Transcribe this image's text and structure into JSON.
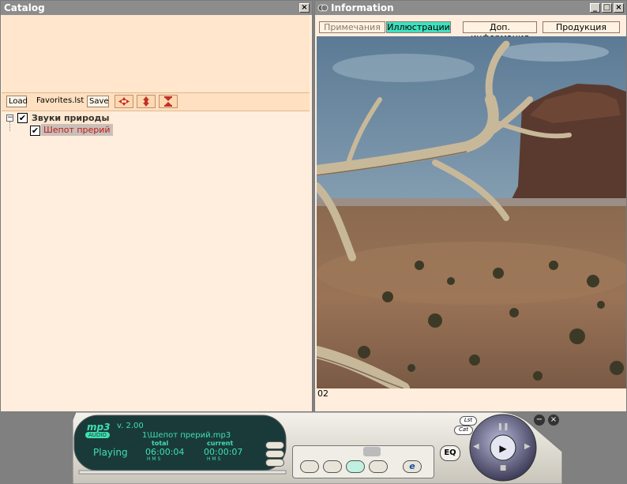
{
  "catalog": {
    "title": "Catalog",
    "close_icon": "close-icon",
    "toolbar": {
      "load_label": "Load",
      "playlist_name": "Favorites.lst",
      "save_label": "Save",
      "move_icons": [
        "move-all-icon",
        "move-up-down-icon",
        "move-to-ends-icon"
      ]
    },
    "tree": {
      "group_label": "Звуки природы",
      "group_checked": true,
      "items": [
        {
          "label": "Шепот прерий",
          "checked": true
        }
      ]
    }
  },
  "information": {
    "title": "Information",
    "window_buttons": [
      "minimize-icon",
      "maximize-icon",
      "close-icon"
    ],
    "tabs": [
      {
        "label": "Примечания",
        "active": false
      },
      {
        "label": "Иллюстрации",
        "active": true
      },
      {
        "label": "Доп. информация",
        "active": false
      },
      {
        "label": "Продукция",
        "active": false
      }
    ],
    "image_caption": "02"
  },
  "player": {
    "logo_text": "mp3",
    "logo_sub": "AUDIO",
    "version": "v. 2.00",
    "track_title": "1\\Шепот прерий.mp3",
    "status": "Playing",
    "total_label": "total",
    "total_time": "06:00:04",
    "current_label": "current",
    "current_time": "00:00:07",
    "hms_label": "H  M  S",
    "eq_label": "EQ",
    "lst_label": "Lst",
    "cat_label": "Cat",
    "accent_color": "#3fe0b0"
  }
}
